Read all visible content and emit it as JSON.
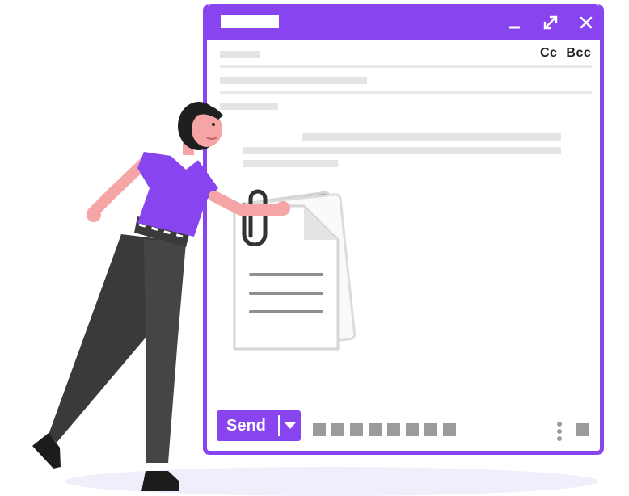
{
  "window": {
    "cc_label": "Cc",
    "bcc_label": "Bcc",
    "send_label": "Send"
  },
  "icons": [
    "minimize-icon",
    "maximize-icon",
    "close-icon",
    "dropdown-caret-icon",
    "more-vertical-icon",
    "paperclip-icon",
    "document-icon"
  ],
  "colors": {
    "accent": "#8844ee",
    "placeholder": "#e4e4e4",
    "icon_gray": "#9b9b9b"
  }
}
